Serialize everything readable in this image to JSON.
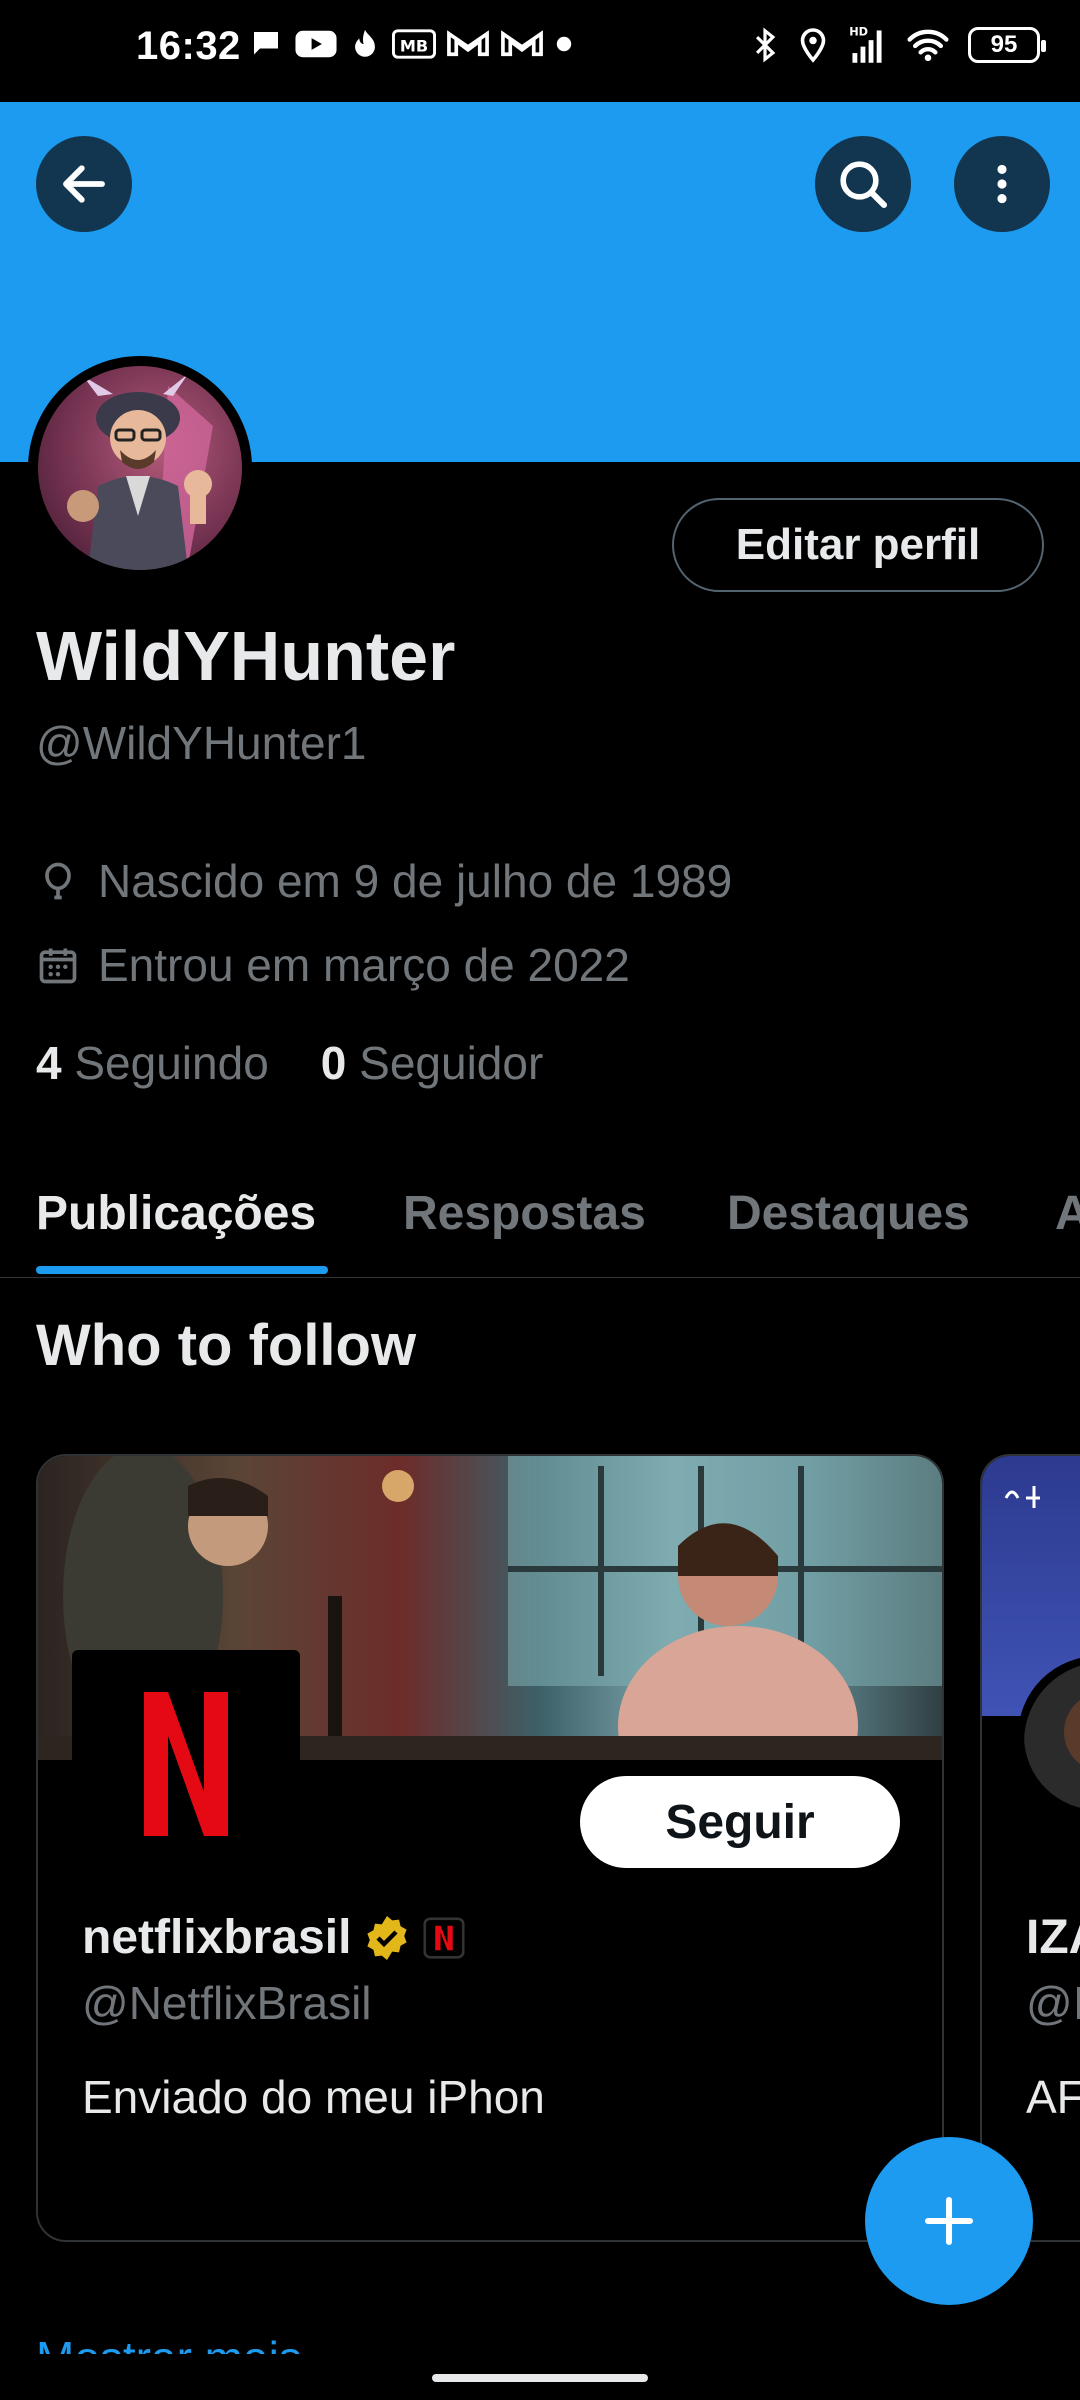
{
  "status_bar": {
    "time": "16:32",
    "battery": "95",
    "left_icons": [
      "chat-bubble-icon",
      "youtube-icon",
      "tinder-icon",
      "mb-icon",
      "gmail-icon",
      "gmail-icon",
      "dot-icon"
    ],
    "right_icons": [
      "bluetooth-icon",
      "location-icon",
      "signal-hd-icon",
      "wifi-icon",
      "battery-icon"
    ]
  },
  "header": {
    "back_icon": "arrow-left-icon",
    "search_icon": "search-icon",
    "more_icon": "more-vertical-icon",
    "banner_color": "#1d9bf0"
  },
  "profile": {
    "edit_label": "Editar perfil",
    "name": "WildYHunter",
    "handle": "@WildYHunter1",
    "born": "Nascido em 9 de julho de 1989",
    "joined": "Entrou em março de 2022",
    "following_count": "4",
    "following_label": "Seguindo",
    "followers_count": "0",
    "followers_label": "Seguidor"
  },
  "tabs": [
    {
      "label": "Publicações",
      "active": true
    },
    {
      "label": "Respostas",
      "active": false
    },
    {
      "label": "Destaques",
      "active": false
    },
    {
      "label": "A",
      "active": false
    }
  ],
  "who_to_follow": {
    "title": "Who to follow",
    "cards": [
      {
        "name": "netflixbrasil",
        "handle": "@NetflixBrasil",
        "bio": "Enviado do meu iPhon",
        "button": "Seguir"
      },
      {
        "name": "IZA",
        "handle": "@I",
        "bio": "AF"
      }
    ],
    "show_more": "Mostrar mais"
  },
  "fab": {
    "icon": "plus-icon"
  },
  "colors": {
    "accent": "#1d9bf0",
    "background": "#000000",
    "muted": "#71767b"
  }
}
